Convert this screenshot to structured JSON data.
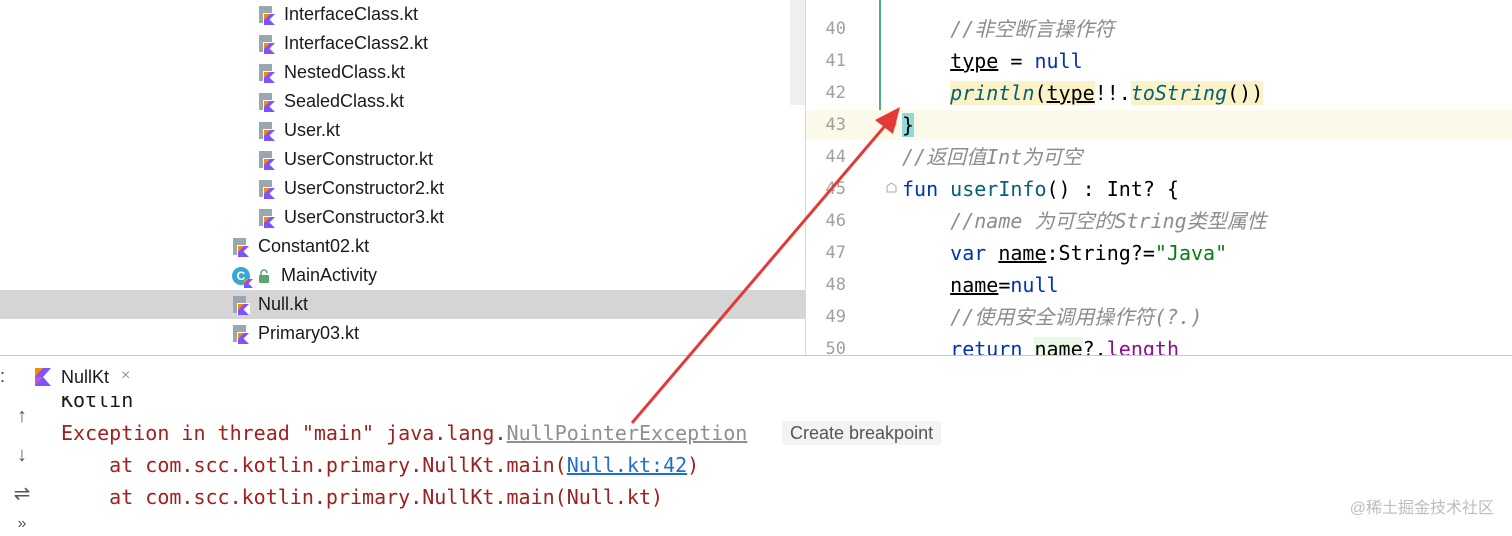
{
  "project_tree": {
    "items": [
      {
        "label": "InterfaceClass.kt"
      },
      {
        "label": "InterfaceClass2.kt"
      },
      {
        "label": "NestedClass.kt"
      },
      {
        "label": "SealedClass.kt"
      },
      {
        "label": "User.kt"
      },
      {
        "label": "UserConstructor.kt"
      },
      {
        "label": "UserConstructor2.kt"
      },
      {
        "label": "UserConstructor3.kt"
      },
      {
        "label": "Constant02.kt"
      },
      {
        "label": "MainActivity"
      },
      {
        "label": "Null.kt",
        "selected": true
      },
      {
        "label": "Primary03.kt"
      }
    ]
  },
  "editor": {
    "line_numbers": [
      "40",
      "41",
      "42",
      "43",
      "44",
      "45",
      "46",
      "47",
      "48",
      "49",
      "50"
    ],
    "code": {
      "l40_comment": "//非空断言操作符",
      "l41_type": "type",
      "l41_eq": " = ",
      "l41_null": "null",
      "l42_println": "println",
      "l42_paren": "(",
      "l42_type": "type",
      "l42_bang": "!!.",
      "l42_tostring": "toString",
      "l42_close": "())",
      "l43_brace": "}",
      "l44_comment": "//返回值Int为可空",
      "l45_fun": "fun",
      "l45_name": " userInfo",
      "l45_rest": "() : Int? {",
      "l46_comment": "//name 为可空的String类型属性",
      "l47_var": "var",
      "l47_name": "name",
      "l47_type": ":String?=",
      "l47_str": "\"Java\"",
      "l48_name": "name",
      "l48_eq": "=",
      "l48_null": "null",
      "l49_comment": "//使用安全调用操作符(?.)",
      "l50_return": "return",
      "l50_name": "name",
      "l50_op": "?.",
      "l50_length": "length"
    }
  },
  "run_panel": {
    "prefix": ":",
    "tab_label": "NullKt",
    "tab_close": "×",
    "toolbar": {
      "up": "↑",
      "down": "↓",
      "wrap": "⇌",
      "more": "»"
    },
    "console": {
      "line1": "Kotlin",
      "line2_prefix": "Exception in thread \"main\" java.lang.",
      "line2_exception": "NullPointerException",
      "breakpoint_hint": "Create breakpoint",
      "line3_prefix": "    at com.scc.kotlin.primary.NullKt.main(",
      "line3_link": "Null.kt:42",
      "line3_suffix": ")",
      "line4": "    at com.scc.kotlin.primary.NullKt.main(Null.kt)"
    }
  },
  "watermark": "@稀土掘金技术社区",
  "colors": {
    "keyword": "#0033b3",
    "comment": "#8c8c8c",
    "function": "#00627a",
    "string": "#067d17",
    "property": "#871094",
    "error": "#a01f1f",
    "link": "#1f6fd1",
    "arrow": "#e53935",
    "selection": "#d5d5d5"
  },
  "icons": {
    "kotlin_file": "kotlin-file-icon",
    "kotlin_class": "kotlin-class-icon",
    "lock": "lock-icon"
  }
}
